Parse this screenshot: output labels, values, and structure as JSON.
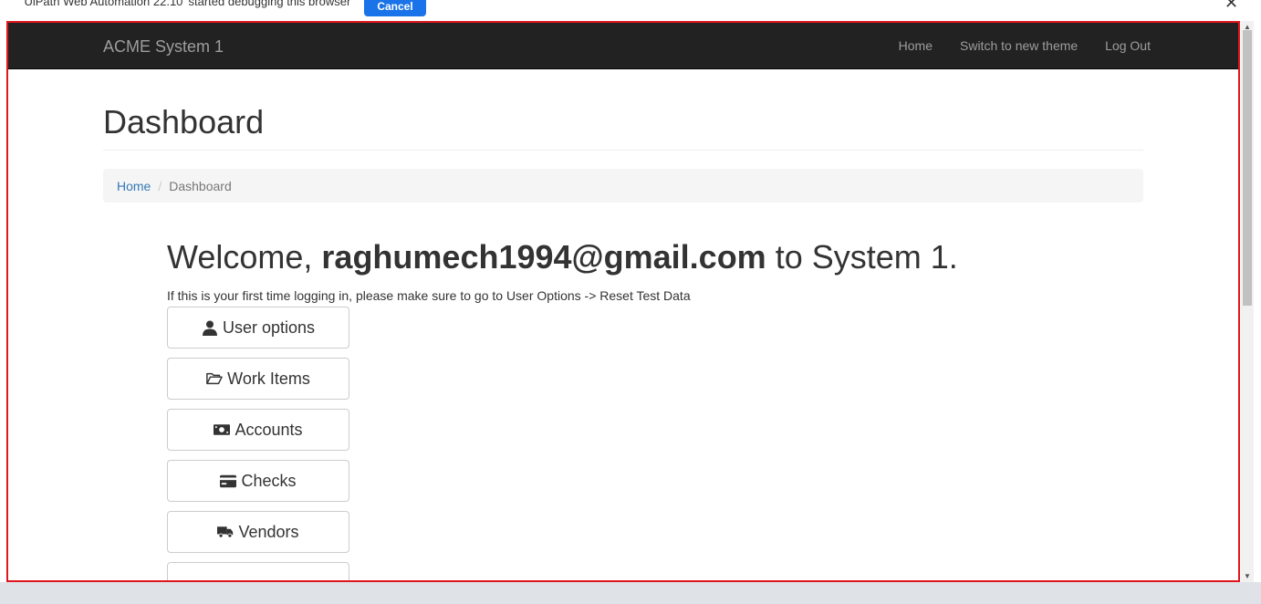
{
  "infobar": {
    "message": "'UiPath Web Automation 22.10' started debugging this browser",
    "cancel_label": "Cancel",
    "close_glyph": "✕"
  },
  "navbar": {
    "brand": "ACME System 1",
    "links": [
      "Home",
      "Switch to new theme",
      "Log Out"
    ]
  },
  "page": {
    "title": "Dashboard",
    "breadcrumb": {
      "home": "Home",
      "separator": "/",
      "current": "Dashboard"
    }
  },
  "welcome": {
    "prefix": "Welcome,",
    "email": "raghumech1994@gmail.com",
    "suffix": "to System 1.",
    "hint": "If this is your first time logging in, please make sure to go to User Options -> Reset Test Data"
  },
  "menu": [
    {
      "label": "User options",
      "icon": "user-icon"
    },
    {
      "label": "Work Items",
      "icon": "folder-icon"
    },
    {
      "label": "Accounts",
      "icon": "money-icon"
    },
    {
      "label": "Checks",
      "icon": "credit-card-icon"
    },
    {
      "label": "Vendors",
      "icon": "truck-icon"
    }
  ],
  "colors": {
    "navbar_bg": "#222222",
    "nav_text": "#9d9d9d",
    "link": "#337ab7",
    "highlight_frame": "#e0161d",
    "infobar_button": "#1a73e8"
  }
}
